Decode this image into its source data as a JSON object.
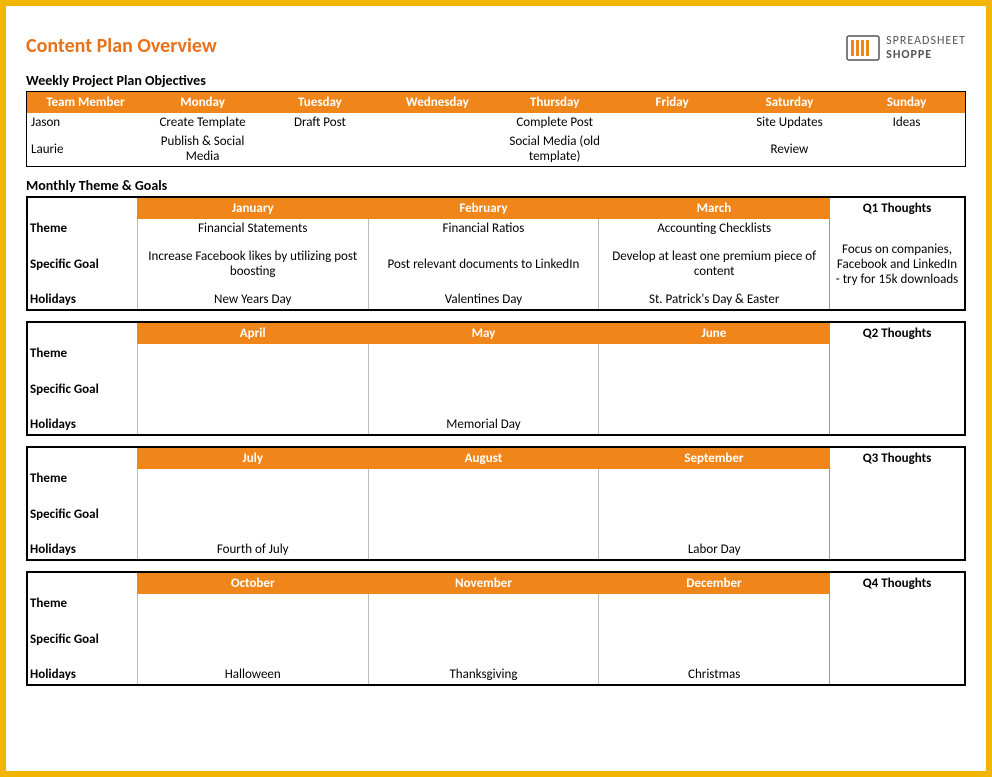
{
  "header": {
    "title": "Content Plan Overview",
    "logo_line1": "SPREADSHEET",
    "logo_line2": "SHOPPE"
  },
  "weekly": {
    "section_label": "Weekly Project Plan Objectives",
    "headers": [
      "Team Member",
      "Monday",
      "Tuesday",
      "Wednesday",
      "Thursday",
      "Friday",
      "Saturday",
      "Sunday"
    ],
    "rows": [
      {
        "member": "Jason",
        "mon": "Create Template",
        "tue": "Draft Post",
        "wed": "",
        "thu": "Complete Post",
        "fri": "",
        "sat": "Site Updates",
        "sun": "Ideas"
      },
      {
        "member": "Laurie",
        "mon": "Publish & Social Media",
        "tue": "",
        "wed": "",
        "thu": "Social Media (old template)",
        "fri": "",
        "sat": "Review",
        "sun": ""
      }
    ]
  },
  "monthly": {
    "section_label": "Monthly Theme & Goals",
    "row_labels": {
      "theme": "Theme",
      "goal": "Specific Goal",
      "holidays": "Holidays"
    },
    "quarters": [
      {
        "months": [
          "January",
          "February",
          "March"
        ],
        "thoughts_label": "Q1 Thoughts",
        "theme": [
          "Financial Statements",
          "Financial Ratios",
          "Accounting Checklists"
        ],
        "goal": [
          "Increase Facebook likes by utilizing post boosting",
          "Post relevant documents to LinkedIn",
          "Develop at least one premium piece of content"
        ],
        "holidays": [
          "New Years Day",
          "Valentines Day",
          "St. Patrick's Day & Easter"
        ],
        "thoughts": "Focus on companies, Facebook and LinkedIn - try for 15k downloads"
      },
      {
        "months": [
          "April",
          "May",
          "June"
        ],
        "thoughts_label": "Q2 Thoughts",
        "theme": [
          "",
          "",
          ""
        ],
        "goal": [
          "",
          "",
          ""
        ],
        "holidays": [
          "",
          "Memorial Day",
          ""
        ],
        "thoughts": ""
      },
      {
        "months": [
          "July",
          "August",
          "September"
        ],
        "thoughts_label": "Q3 Thoughts",
        "theme": [
          "",
          "",
          ""
        ],
        "goal": [
          "",
          "",
          ""
        ],
        "holidays": [
          "Fourth of July",
          "",
          "Labor Day"
        ],
        "thoughts": ""
      },
      {
        "months": [
          "October",
          "November",
          "December"
        ],
        "thoughts_label": "Q4 Thoughts",
        "theme": [
          "",
          "",
          ""
        ],
        "goal": [
          "",
          "",
          ""
        ],
        "holidays": [
          "Halloween",
          "Thanksgiving",
          "Christmas"
        ],
        "thoughts": ""
      }
    ]
  }
}
